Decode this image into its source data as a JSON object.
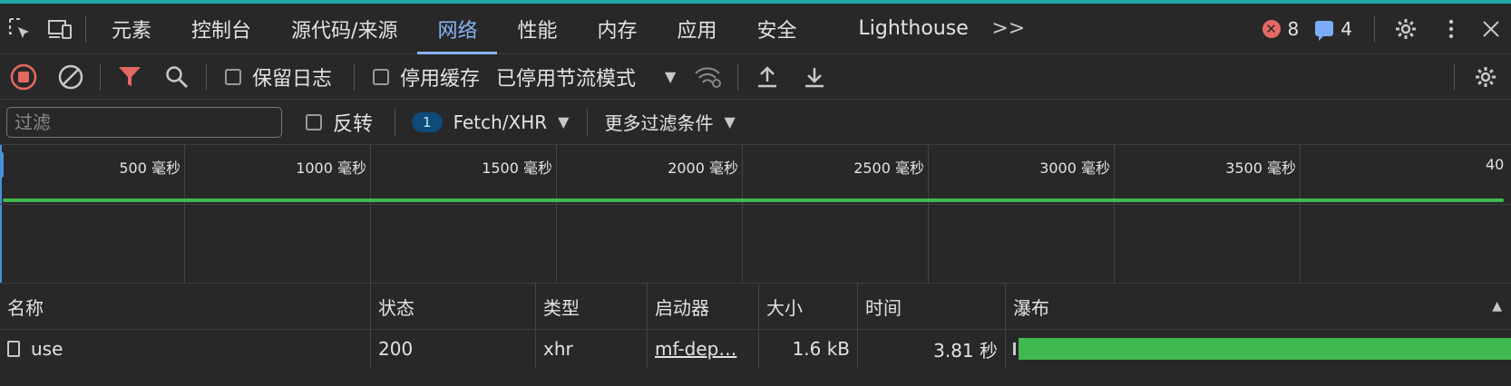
{
  "tabs": {
    "items": [
      "元素",
      "控制台",
      "源代码/来源",
      "网络",
      "性能",
      "内存",
      "应用",
      "安全",
      "Lighthouse"
    ],
    "more_glyph": ">>",
    "error_count": "8",
    "message_count": "4"
  },
  "toolbar": {
    "preserve_log_label": "保留日志",
    "disable_cache_label": "停用缓存",
    "throttle_label": "已停用节流模式"
  },
  "filter": {
    "placeholder": "过滤",
    "invert_label": "反转",
    "fetch_count": "1",
    "fetch_label": "Fetch/XHR",
    "more_filters_label": "更多过滤条件"
  },
  "overview": {
    "ticks": [
      "500 毫秒",
      "1000 毫秒",
      "1500 毫秒",
      "2000 毫秒",
      "2500 毫秒",
      "3000 毫秒",
      "3500 毫秒",
      "40"
    ]
  },
  "table": {
    "headers": {
      "name": "名称",
      "status": "状态",
      "type": "类型",
      "initiator": "启动器",
      "size": "大小",
      "time": "时间",
      "waterfall": "瀑布"
    },
    "rows": [
      {
        "name": "use",
        "status": "200",
        "type": "xhr",
        "initiator": "mf-dep…",
        "size": "1.6 kB",
        "time": "3.81 秒"
      }
    ]
  },
  "colors": {
    "accent": "#8ab4f8",
    "error": "#e46962",
    "success_bar": "#3fb950",
    "record": "#e46962",
    "filter_icon": "#e46962"
  }
}
